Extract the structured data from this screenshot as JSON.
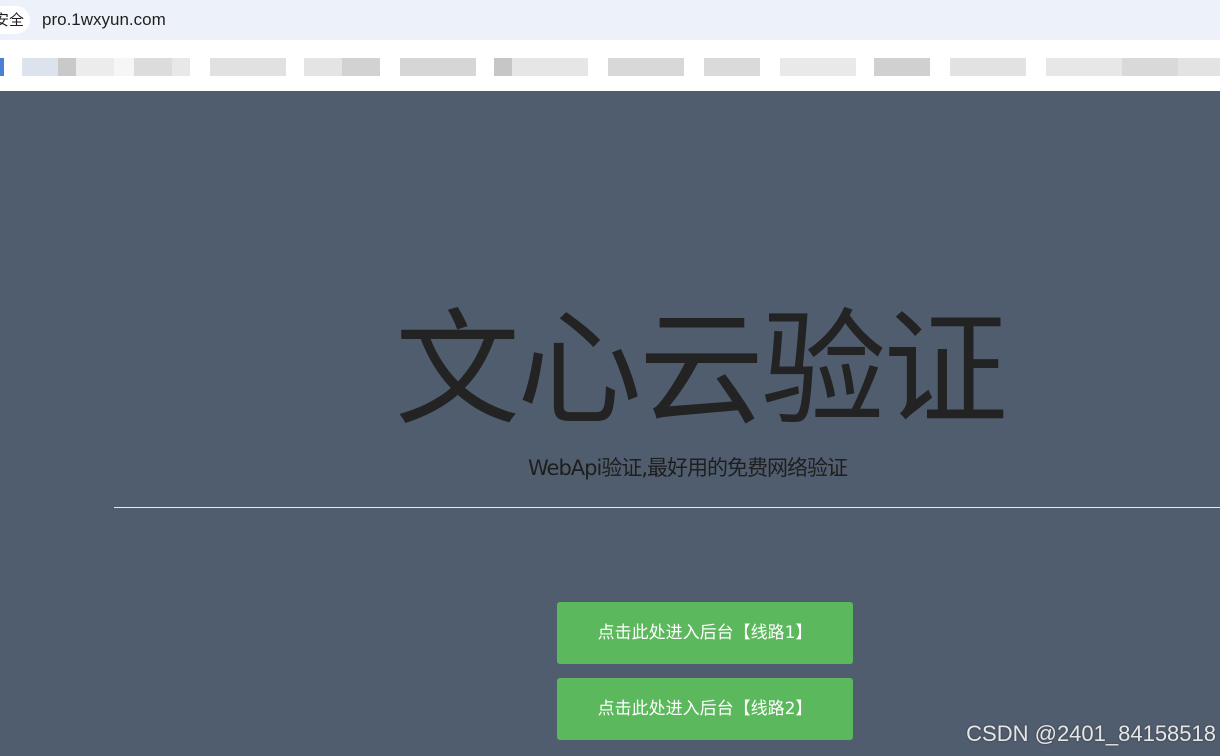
{
  "browser": {
    "security_label": "安全",
    "url": "pro.1wxyun.com"
  },
  "hero": {
    "title": "文心云验证",
    "subtitle": "WebApi验证,最好用的免费网络验证"
  },
  "buttons": [
    {
      "label": "点击此处进入后台【线路1】"
    },
    {
      "label": "点击此处进入后台【线路2】"
    }
  ],
  "watermark": "CSDN @2401_84158518",
  "colors": {
    "page_background": "#505d6e",
    "button_green": "#5cb85c",
    "address_bar": "#edf2fa"
  }
}
